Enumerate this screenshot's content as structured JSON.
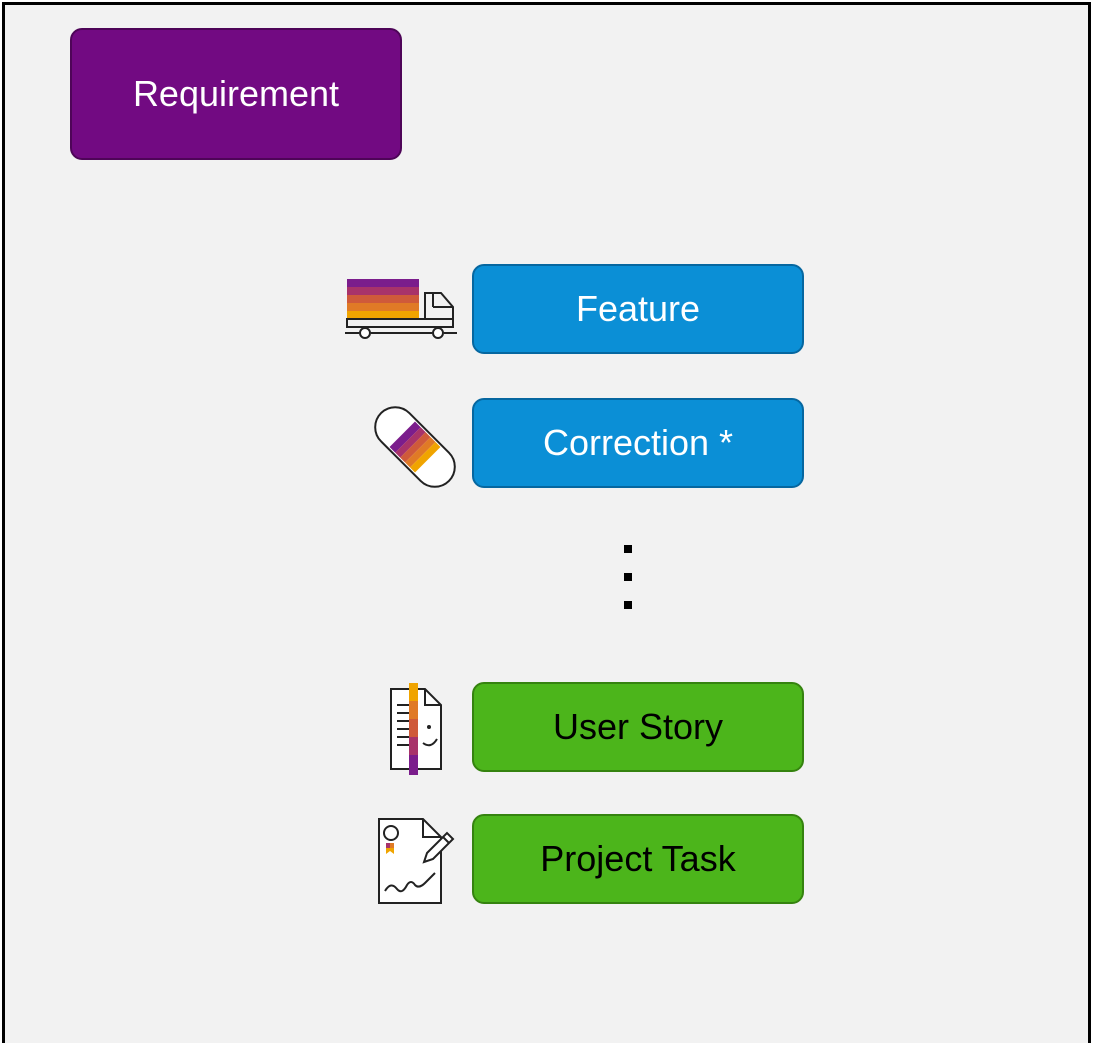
{
  "diagram": {
    "requirement": {
      "label": "Requirement",
      "color": "#720a82"
    },
    "items": [
      {
        "label": "Feature",
        "icon": "truck-icon",
        "color": "#0b8fd6"
      },
      {
        "label": "Correction *",
        "icon": "bandage-icon",
        "color": "#0b8fd6"
      },
      {
        "label": "User Story",
        "icon": "document-face-icon",
        "color": "#4cb51b"
      },
      {
        "label": "Project Task",
        "icon": "signed-contract-icon",
        "color": "#4cb51b"
      }
    ],
    "ellipsis": "vertical-ellipsis-icon"
  }
}
